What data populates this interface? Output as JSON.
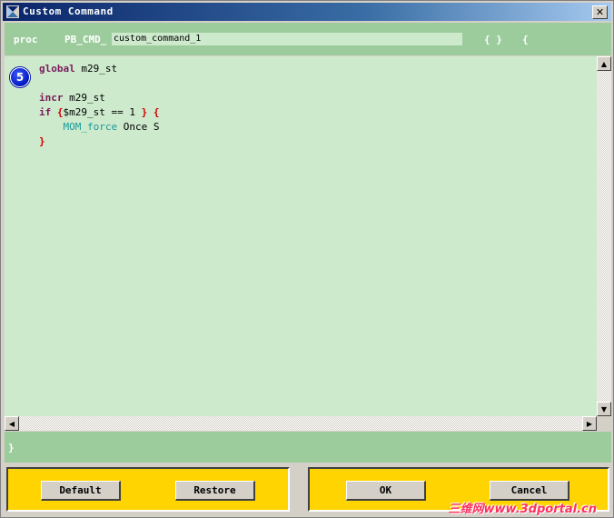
{
  "window": {
    "title": "Custom Command"
  },
  "header": {
    "proc_label": "proc",
    "prefix": "PB_CMD_",
    "command_name": "custom_command_1",
    "brace_pair": "{ }",
    "open_brace": "{"
  },
  "editor": {
    "step_number": "5",
    "lines": {
      "l1_kw": "global",
      "l1_rest": " m29_st",
      "l3_kw": "incr",
      "l3_rest": " m29_st",
      "l4_kw": "if",
      "l4_open": "{",
      "l4_expr": "$m29_st == 1 ",
      "l4_close": "}",
      "l4_body_open": "{",
      "l5_fn": "MOM_force",
      "l5_rest": " Once S",
      "l6_close": "}"
    }
  },
  "footer": {
    "close_brace": "}"
  },
  "buttons": {
    "default": "Default",
    "restore": "Restore",
    "ok": "OK",
    "cancel": "Cancel"
  },
  "watermark": {
    "text": "三维网www.3dportal.cn"
  },
  "colors": {
    "panel_green": "#9ccc9c",
    "editor_bg": "#cdeacd",
    "button_panel": "#ffd400",
    "keyword": "#7a1a5a",
    "brace": "#d00000",
    "function": "#1a9a9a"
  }
}
